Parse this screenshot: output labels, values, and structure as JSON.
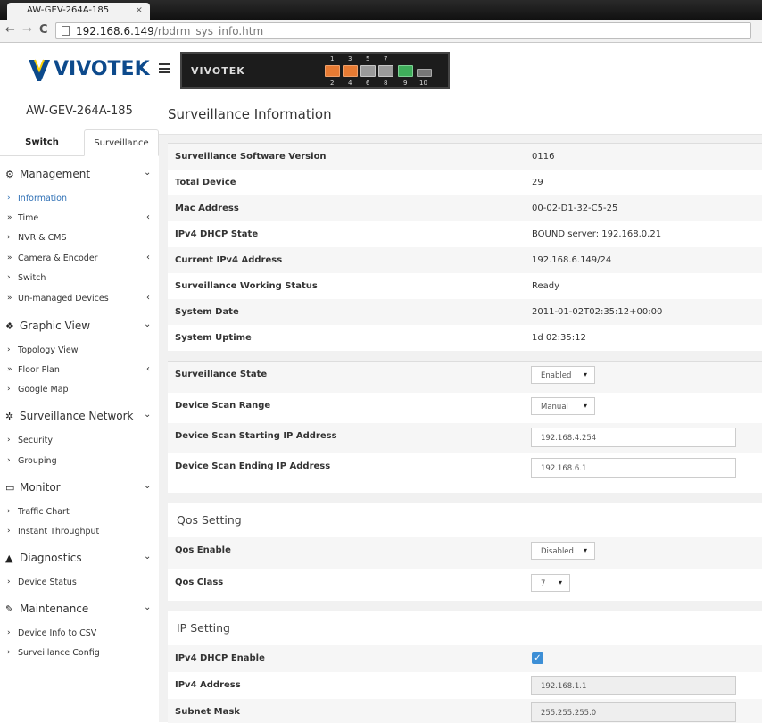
{
  "browser": {
    "tab_title": "AW-GEV-264A-185",
    "tab_close": "×",
    "url_host": "192.168.6.149",
    "url_path": "/rbdrm_sys_info.htm",
    "back_glyph": "←",
    "forward_glyph": "→",
    "reload_glyph": "C"
  },
  "header": {
    "brand": "VIVOTEK",
    "panel_brand": "VIVOTEK",
    "ports_top": [
      "1",
      "3",
      "5",
      "7"
    ],
    "ports_bottom": [
      "2",
      "4",
      "6",
      "8",
      "9",
      "10"
    ]
  },
  "sidebar": {
    "device_name": "AW-GEV-264A-185",
    "tabs": [
      "Switch",
      "Surveillance"
    ],
    "groups": [
      {
        "label": "Management",
        "icon": "gear-icon",
        "glyph": "⚙",
        "items": [
          {
            "label": "Information",
            "active": true,
            "submenu": false
          },
          {
            "label": "Time",
            "submenu": true
          },
          {
            "label": "NVR & CMS",
            "submenu": false
          },
          {
            "label": "Camera & Encoder",
            "submenu": true
          },
          {
            "label": "Switch",
            "submenu": false
          },
          {
            "label": "Un-managed Devices",
            "submenu": true
          }
        ]
      },
      {
        "label": "Graphic View",
        "icon": "share-icon",
        "glyph": "❖",
        "items": [
          {
            "label": "Topology View",
            "submenu": false
          },
          {
            "label": "Floor Plan",
            "submenu": true
          },
          {
            "label": "Google Map",
            "submenu": false
          }
        ]
      },
      {
        "label": "Surveillance Network",
        "icon": "cogs-icon",
        "glyph": "✲",
        "items": [
          {
            "label": "Security",
            "submenu": false
          },
          {
            "label": "Grouping",
            "submenu": false
          }
        ]
      },
      {
        "label": "Monitor",
        "icon": "monitor-icon",
        "glyph": "▭",
        "items": [
          {
            "label": "Traffic Chart",
            "submenu": false
          },
          {
            "label": "Instant Throughput",
            "submenu": false
          }
        ]
      },
      {
        "label": "Diagnostics",
        "icon": "sitemap-icon",
        "glyph": "▲",
        "items": [
          {
            "label": "Device Status",
            "submenu": false
          }
        ]
      },
      {
        "label": "Maintenance",
        "icon": "wrench-icon",
        "glyph": "✎",
        "items": [
          {
            "label": "Device Info to CSV",
            "submenu": false
          },
          {
            "label": "Surveillance Config",
            "submenu": false
          }
        ]
      }
    ]
  },
  "main": {
    "title": "Surveillance Information",
    "info_rows": [
      {
        "label": "Surveillance Software Version",
        "value": "0116"
      },
      {
        "label": "Total Device",
        "value": "29"
      },
      {
        "label": "Mac Address",
        "value": "00-02-D1-32-C5-25"
      },
      {
        "label": "IPv4 DHCP State",
        "value": "BOUND server: 192.168.0.21"
      },
      {
        "label": "Current IPv4 Address",
        "value": "192.168.6.149/24"
      },
      {
        "label": "Surveillance Working Status",
        "value": "Ready"
      },
      {
        "label": "System Date",
        "value": "2011-01-02T02:35:12+00:00"
      },
      {
        "label": "System Uptime",
        "value": "1d 02:35:12"
      }
    ],
    "scan": {
      "state_label": "Surveillance State",
      "state_value": "Enabled",
      "range_label": "Device Scan Range",
      "range_value": "Manual",
      "start_label": "Device Scan Starting IP Address",
      "start_value": "192.168.4.254",
      "end_label": "Device Scan Ending IP Address",
      "end_value": "192.168.6.1"
    },
    "qos": {
      "title": "Qos Setting",
      "enable_label": "Qos Enable",
      "enable_value": "Disabled",
      "class_label": "Qos Class",
      "class_value": "7"
    },
    "ip": {
      "title": "IP Setting",
      "dhcp_label": "IPv4 DHCP Enable",
      "dhcp_checked": "✓",
      "addr_label": "IPv4 Address",
      "addr_value": "192.168.1.1",
      "mask_label": "Subnet Mask",
      "mask_value": "255.255.255.0"
    },
    "caret": "▾"
  }
}
